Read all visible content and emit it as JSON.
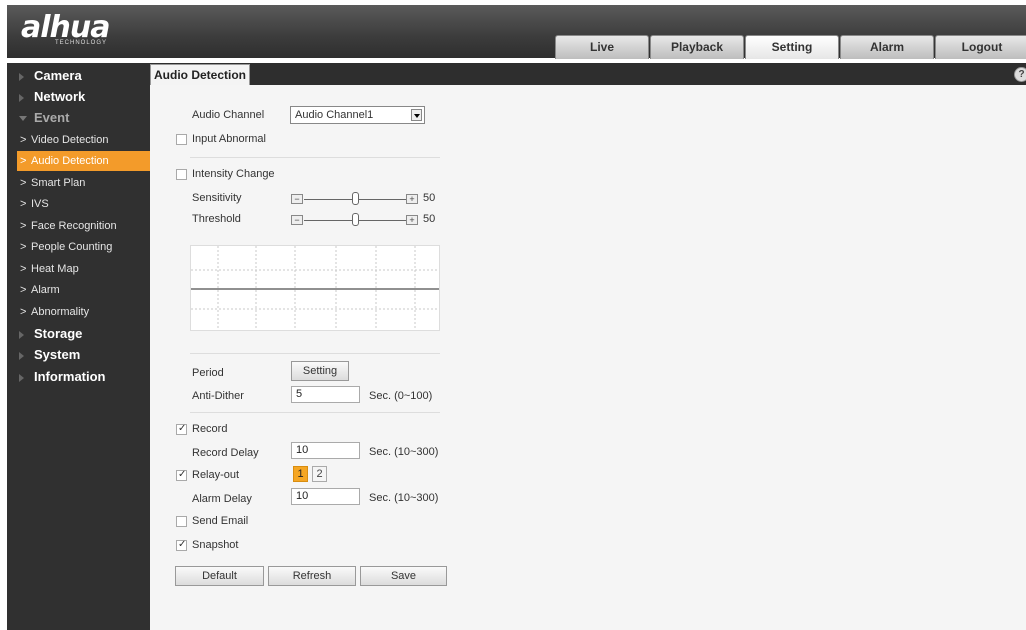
{
  "brand": {
    "name": "alhua",
    "sub": "TECHNOLOGY"
  },
  "nav": {
    "tabs": [
      {
        "label": "Live"
      },
      {
        "label": "Playback"
      },
      {
        "label": "Setting"
      },
      {
        "label": "Alarm"
      },
      {
        "label": "Logout"
      }
    ],
    "active": "Setting"
  },
  "sidebar": {
    "camera": "Camera",
    "network": "Network",
    "event": "Event",
    "event_items": [
      "Video Detection",
      "Audio Detection",
      "Smart Plan",
      "IVS",
      "Face Recognition",
      "People Counting",
      "Heat Map",
      "Alarm",
      "Abnormality"
    ],
    "active_item": "Audio Detection",
    "storage": "Storage",
    "system": "System",
    "information": "Information"
  },
  "page": {
    "title": "Audio Detection",
    "help": "?"
  },
  "form": {
    "audio_channel_label": "Audio Channel",
    "audio_channel_value": "Audio Channel1",
    "input_abnormal_label": "Input Abnormal",
    "intensity_change_label": "Intensity Change",
    "sensitivity_label": "Sensitivity",
    "sensitivity_value": "50",
    "threshold_label": "Threshold",
    "threshold_value": "50",
    "period_label": "Period",
    "period_button": "Setting",
    "anti_dither_label": "Anti-Dither",
    "anti_dither_value": "5",
    "anti_dither_unit": "Sec. (0~100)",
    "record_label": "Record",
    "record_delay_label": "Record Delay",
    "record_delay_value": "10",
    "record_delay_unit": "Sec. (10~300)",
    "relay_out_label": "Relay-out",
    "relay_1": "1",
    "relay_2": "2",
    "alarm_delay_label": "Alarm Delay",
    "alarm_delay_value": "10",
    "alarm_delay_unit": "Sec. (10~300)",
    "send_email_label": "Send Email",
    "snapshot_label": "Snapshot",
    "default_button": "Default",
    "refresh_button": "Refresh",
    "save_button": "Save"
  },
  "slider_icons": {
    "minus": "−",
    "plus": "+"
  },
  "colors": {
    "accent": "#f39b2a",
    "relay_on": "#f5a623"
  }
}
